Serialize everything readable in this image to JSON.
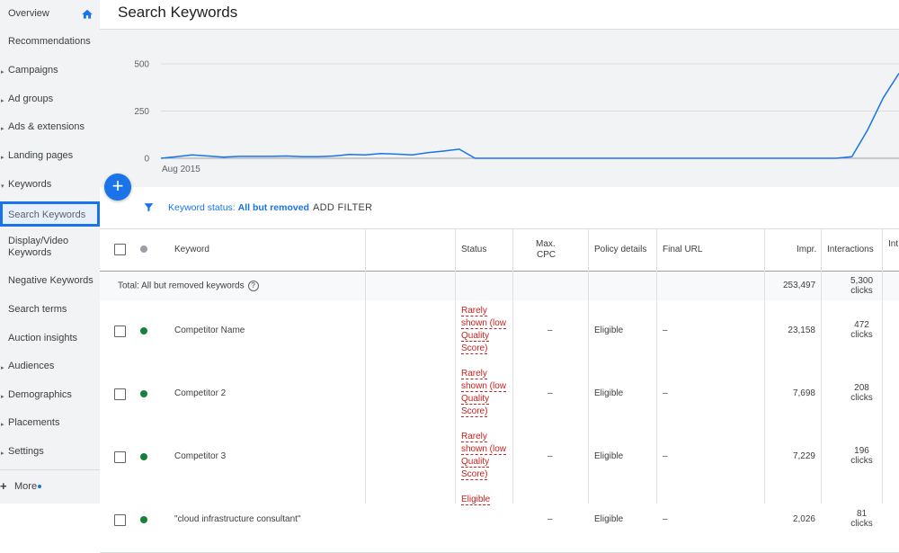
{
  "sidebar": {
    "items": [
      {
        "label": "Overview"
      },
      {
        "label": "Recommendations"
      },
      {
        "label": "Campaigns"
      },
      {
        "label": "Ad groups"
      },
      {
        "label": "Ads & extensions"
      },
      {
        "label": "Landing pages"
      },
      {
        "label": "Keywords"
      },
      {
        "label": "Search Keywords"
      },
      {
        "label": "Display/Video Keywords"
      },
      {
        "label": "Negative Keywords"
      },
      {
        "label": "Search terms"
      },
      {
        "label": "Auction insights"
      },
      {
        "label": "Audiences"
      },
      {
        "label": "Demographics"
      },
      {
        "label": "Placements"
      },
      {
        "label": "Settings"
      }
    ],
    "more_label": "More",
    "more_symbol": "+"
  },
  "header": {
    "title": "Search Keywords"
  },
  "chart_data": {
    "type": "line",
    "color": "#1a73e8",
    "ylim": [
      0,
      550
    ],
    "y_ticks": [
      "500",
      "250",
      "0"
    ],
    "x_label": "Aug 2015",
    "values": [
      0,
      8,
      18,
      12,
      6,
      10,
      10,
      10,
      12,
      8,
      8,
      12,
      20,
      18,
      25,
      22,
      18,
      30,
      38,
      48,
      0,
      0,
      0,
      0,
      0,
      0,
      0,
      0,
      0,
      0,
      0,
      0,
      0,
      0,
      0,
      0,
      0,
      0,
      0,
      0,
      0,
      0,
      0,
      0,
      8,
      150,
      320,
      450
    ]
  },
  "fab": {
    "symbol": "+"
  },
  "filter": {
    "prefix": "Keyword status: ",
    "value": "All but removed",
    "add_label": "ADD FILTER"
  },
  "table": {
    "columns": {
      "keyword": "Keyword",
      "status": "Status",
      "max_cpc_1": "Max.",
      "max_cpc_2": "CPC",
      "policy": "Policy details",
      "final_url": "Final URL",
      "impr": "Impr.",
      "interactions": "Interactions",
      "extra": "Int"
    },
    "total": {
      "label": "Total: All but removed keywords",
      "help": "?",
      "impr": "253,497",
      "interactions": "5,300",
      "interactions_unit": "clicks"
    },
    "rows": [
      {
        "keyword": "Competitor Name",
        "status": [
          "Rarely",
          "shown (low",
          "Quality",
          "Score)"
        ],
        "max_cpc": "–",
        "policy": "Eligible",
        "final_url": "–",
        "impr": "23,158",
        "interactions": "472",
        "unit": "clicks"
      },
      {
        "keyword": "Competitor 2",
        "status": [
          "Rarely",
          "shown (low",
          "Quality",
          "Score)"
        ],
        "max_cpc": "–",
        "policy": "Eligible",
        "final_url": "–",
        "impr": "7,698",
        "interactions": "208",
        "unit": "clicks"
      },
      {
        "keyword": "Competitor 3",
        "status": [
          "Rarely",
          "shown (low",
          "Quality",
          "Score)"
        ],
        "max_cpc": "–",
        "policy": "Eligible",
        "final_url": "–",
        "impr": "7,229",
        "interactions": "196",
        "unit": "clicks"
      },
      {
        "keyword": "\"cloud infrastructure consultant\"",
        "status": [
          "Eligible"
        ],
        "max_cpc": "–",
        "policy": "Eligible",
        "final_url": "–",
        "impr": "2,026",
        "interactions": "81",
        "unit": "clicks"
      }
    ]
  },
  "colors": {
    "accent": "#1a73e8",
    "status_warning": "#c5221f",
    "enabled_dot": "#188038",
    "header_dot": "#9aa0a6"
  }
}
